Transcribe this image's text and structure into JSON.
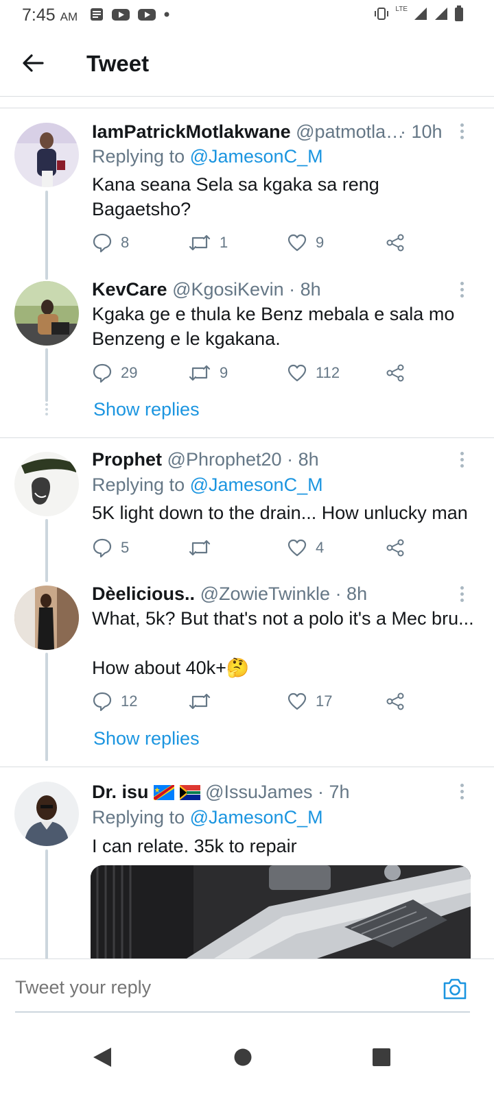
{
  "status_bar": {
    "time": "7:45",
    "ampm": "AM",
    "network_label": "LTE"
  },
  "header": {
    "back_icon": "arrow-left-icon",
    "title": "Tweet"
  },
  "tweets": [
    {
      "name": "IamPatrickMotlakwane",
      "handle": "@patmotla…",
      "time": "· 10h",
      "replying_prefix": "Replying to",
      "replying_to": "@JamesonC_M",
      "text": "Kana seana Sela sa kgaka sa reng Bagaetsho?",
      "replies": "8",
      "retweets": "1",
      "likes": "9"
    },
    {
      "name": "KevCare",
      "handle": "@KgosiKevin",
      "time": "· 8h",
      "text": "Kgaka ge e thula ke Benz mebala e sala mo Benzeng e le kgakana.",
      "replies": "29",
      "retweets": "9",
      "likes": "112",
      "show_replies": "Show replies"
    },
    {
      "name": "Prophet",
      "handle": "@Phrophet20",
      "time": "· 8h",
      "replying_prefix": "Replying to",
      "replying_to": "@JamesonC_M",
      "text": "5K light down to the drain... How unlucky man",
      "replies": "5",
      "retweets": "",
      "likes": "4"
    },
    {
      "name": "Dèelicious..",
      "handle": "@ZowieTwinkle",
      "time": "· 8h",
      "text_line1": "What, 5k? But that's not a polo it's a Mec bru...",
      "text_line2": "How about 40k+🤔",
      "replies": "12",
      "retweets": "",
      "likes": "17",
      "show_replies": "Show replies"
    },
    {
      "name": "Dr. isu",
      "handle": "@IssuJames",
      "time": "· 7h",
      "replying_prefix": "Replying to",
      "replying_to": "@JamesonC_M",
      "text": "I can relate.  35k to repair"
    }
  ],
  "reply_bar": {
    "placeholder": "Tweet your reply",
    "camera_icon": "camera-icon"
  },
  "colors": {
    "accent": "#1b95e0",
    "text": "#14171a",
    "muted": "#657786",
    "divider": "#d9dde0"
  }
}
